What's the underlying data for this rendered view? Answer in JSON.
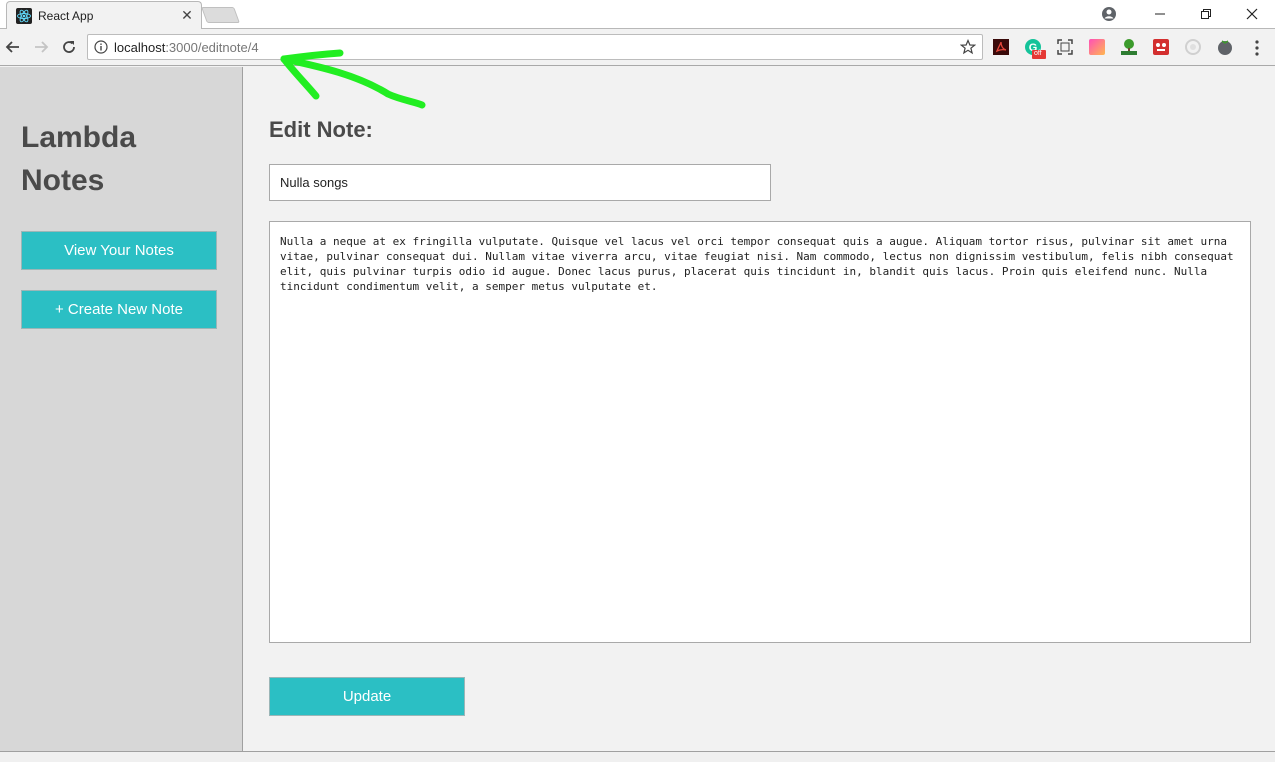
{
  "browser": {
    "tab_title": "React App",
    "url_host": "localhost",
    "url_path": ":3000/editnote/4",
    "extension_badge": "off"
  },
  "sidebar": {
    "title": "Lambda Notes",
    "buttons": {
      "view_notes": "View Your Notes",
      "create_note": "+ Create New Note"
    }
  },
  "editor": {
    "heading": "Edit Note:",
    "title_value": "Nulla songs",
    "body_value": "Nulla a neque at ex fringilla vulputate. Quisque vel lacus vel orci tempor consequat quis a augue. Aliquam tortor risus, pulvinar sit amet urna vitae, pulvinar consequat dui. Nullam vitae viverra arcu, vitae feugiat nisi. Nam commodo, lectus non dignissim vestibulum, felis nibh consequat elit, quis pulvinar turpis odio id augue. Donec lacus purus, placerat quis tincidunt in, blandit quis lacus. Proin quis eleifend nunc. Nulla tincidunt condimentum velit, a semper metus vulputate et.",
    "update_label": "Update"
  },
  "colors": {
    "accent": "#2bbfc4",
    "sidebar_bg": "#d7d7d7",
    "page_bg": "#f2f2f2",
    "annotation_arrow": "#22ee22"
  }
}
